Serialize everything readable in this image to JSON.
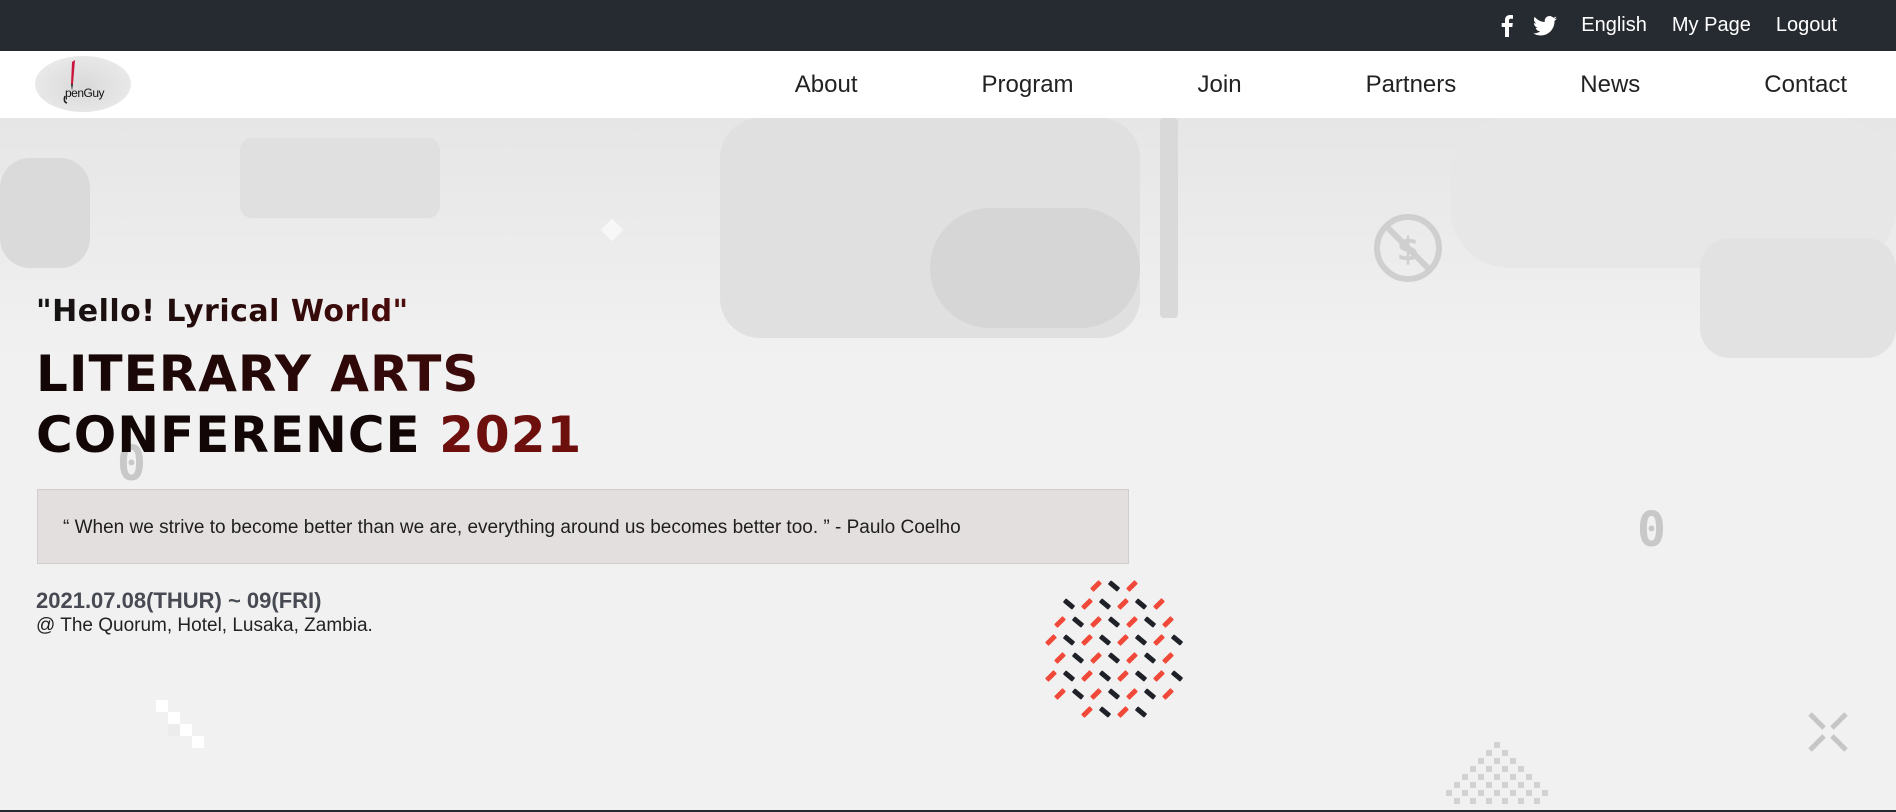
{
  "topbar": {
    "social": [
      {
        "icon": "facebook-icon"
      },
      {
        "icon": "twitter-icon"
      }
    ],
    "links": [
      "English",
      "My Page",
      "Logout"
    ]
  },
  "nav": {
    "logo_text": "penGuy",
    "items": [
      "About",
      "Program",
      "Join",
      "Partners",
      "News",
      "Contact"
    ]
  },
  "hero": {
    "subtitle": "\"Hello! Lyrical World\"",
    "headline_line1": "LITERARY ARTS",
    "headline_line2_prefix": "CONFERENCE ",
    "headline_line2_year": "2021",
    "quote": "“ When we strive to become better than we are, everything around us becomes better too. ” - Paulo Coelho",
    "date": "2021.07.08(THUR) ~ 09(FRI)",
    "venue": "@ The Quorum, Hotel, Lusaka, Zambia.",
    "deco_glyph": "0"
  },
  "colors": {
    "topbar_bg": "#262a31",
    "accent_dark_red": "#6d0f0d",
    "quote_bg": "#e4dfdf",
    "dot_red": "#f0493a",
    "dot_dark": "#1e2128"
  }
}
